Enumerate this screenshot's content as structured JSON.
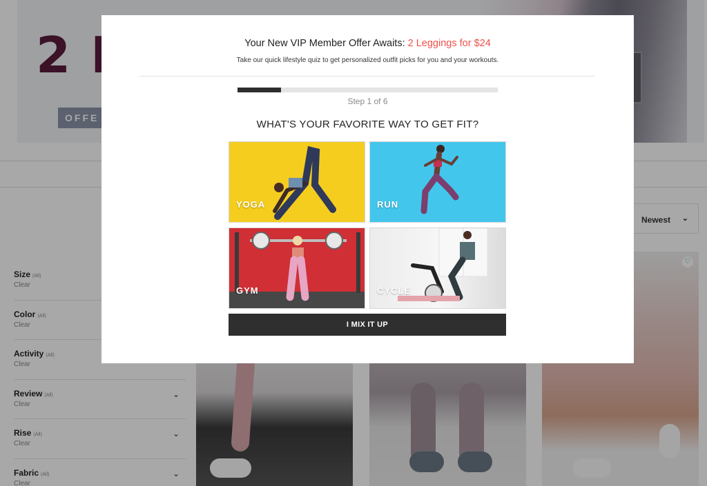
{
  "hero": {
    "title": "2 L",
    "offer_label": "OFFE"
  },
  "sort": {
    "selected": "Newest"
  },
  "filters": [
    {
      "name": "Size",
      "all": "(All)",
      "clear": "Clear",
      "expandable": false
    },
    {
      "name": "Color",
      "all": "(All)",
      "clear": "Clear",
      "expandable": false
    },
    {
      "name": "Activity",
      "all": "(All)",
      "clear": "Clear",
      "expandable": false
    },
    {
      "name": "Review",
      "all": "(All)",
      "clear": "Clear",
      "expandable": true
    },
    {
      "name": "Rise",
      "all": "(All)",
      "clear": "Clear",
      "expandable": true
    },
    {
      "name": "Fabric",
      "all": "(All)",
      "clear": "Clear",
      "expandable": true
    }
  ],
  "modal": {
    "title_prefix": "Your New VIP Member Offer Awaits: ",
    "title_offer": "2 Leggings for $24",
    "subtitle": "Take our quick lifestyle quiz to get personalized outfit picks for you and your workouts.",
    "progress_fraction": 0.1667,
    "step_text": "Step 1 of 6",
    "question": "WHAT'S YOUR FAVORITE WAY TO GET FIT?",
    "choices": [
      {
        "label": "YOGA"
      },
      {
        "label": "RUN"
      },
      {
        "label": "GYM"
      },
      {
        "label": "CYCLE"
      }
    ],
    "mix_button": "I MIX IT UP",
    "accent_color": "#f0504a"
  },
  "icons": {
    "chevron": "chevron-down-icon",
    "heart": "heart-icon"
  }
}
